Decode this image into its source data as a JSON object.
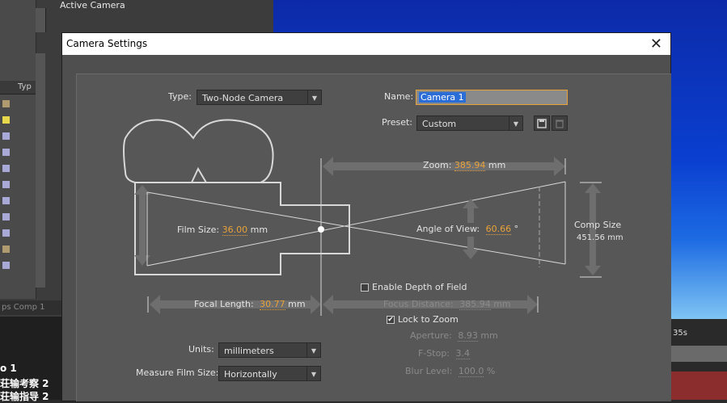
{
  "background": {
    "active_camera_label": "Active Camera",
    "project_type_header": "Typ",
    "comp_tab": "ps Comp 1",
    "timeline_rows": [
      "o 1",
      "荘输考察 2",
      "荘输指导 2"
    ],
    "time_marker": "35s"
  },
  "dialog": {
    "title": "Camera Settings",
    "close_icon": "close-icon"
  },
  "type": {
    "label": "Type:",
    "value": "Two-Node Camera"
  },
  "name": {
    "label": "Name:",
    "value": "Camera 1"
  },
  "preset": {
    "label": "Preset:",
    "value": "Custom",
    "save_icon": "save-icon",
    "delete_icon": "trash-icon"
  },
  "zoom": {
    "label": "Zoom:",
    "value": "385.94",
    "unit": "mm"
  },
  "film_size": {
    "label": "Film Size:",
    "value": "36.00",
    "unit": "mm"
  },
  "angle_of_view": {
    "label": "Angle of View:",
    "value": "60.66",
    "unit": "°"
  },
  "comp_size": {
    "label": "Comp Size",
    "value": "451.56 mm"
  },
  "focal_length": {
    "label": "Focal Length:",
    "value": "30.77",
    "unit": "mm"
  },
  "depth_of_field": {
    "label": "Enable Depth of Field",
    "checked": false
  },
  "focus_distance": {
    "label": "Focus Distance:",
    "value": "385.94",
    "unit": "mm"
  },
  "lock_to_zoom": {
    "label": "Lock to Zoom",
    "checked": true,
    "check_mark": "✔"
  },
  "aperture": {
    "label": "Aperture:",
    "value": "8.93",
    "unit": "mm"
  },
  "fstop": {
    "label": "F-Stop:",
    "value": "3.4"
  },
  "blur_level": {
    "label": "Blur Level:",
    "value": "100.0",
    "unit": "%"
  },
  "units": {
    "label": "Units:",
    "value": "millimeters"
  },
  "measure_film_size": {
    "label": "Measure Film Size:",
    "value": "Horizontally"
  },
  "colors": {
    "accent": "#e8a23a",
    "panel": "#575757",
    "diagram_line": "#d8d8d8",
    "arrow_fill": "#6e6e6e"
  }
}
